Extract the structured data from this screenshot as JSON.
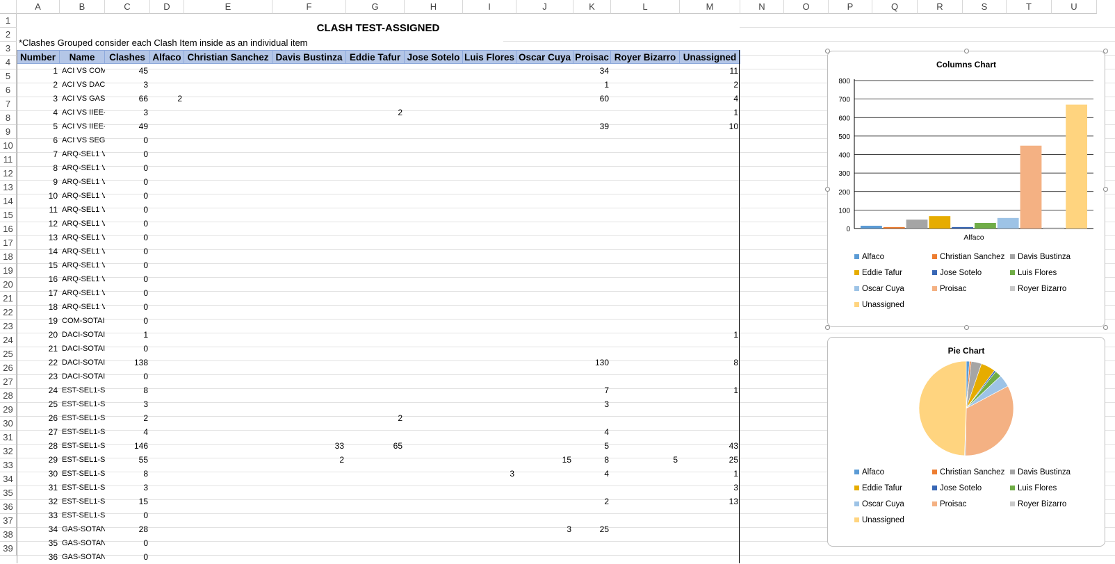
{
  "columns": [
    "A",
    "B",
    "C",
    "D",
    "E",
    "F",
    "G",
    "H",
    "I",
    "J",
    "K",
    "L",
    "M",
    "N",
    "O",
    "P",
    "Q",
    "R",
    "S",
    "T",
    "U"
  ],
  "row_numbers": [
    1,
    2,
    3,
    4,
    5,
    6,
    7,
    8,
    9,
    10,
    11,
    12,
    13,
    14,
    15,
    16,
    17,
    18,
    19,
    20,
    21,
    22,
    23,
    24,
    25,
    26,
    27,
    28,
    29,
    30,
    31,
    32,
    33,
    34,
    35,
    36,
    37,
    38,
    39
  ],
  "title": "CLASH TEST-ASSIGNED",
  "note": "*Clashes Grouped consider each Clash Item inside as an individual item",
  "headers": [
    "Number",
    "Name",
    "Clashes",
    "Alfaco",
    "Christian Sanchez",
    "Davis Bustinza",
    "Eddie Tafur",
    "Jose Sotelo",
    "Luis Flores",
    "Oscar Cuya",
    "Proisac",
    "Royer Bizarro",
    "Unassigned"
  ],
  "rows": [
    {
      "n": "1",
      "name": "ACI VS COM",
      "clashes": "45",
      "vals": [
        "",
        "",
        "",
        "",
        "",
        "",
        "",
        "34",
        "",
        "11"
      ]
    },
    {
      "n": "2",
      "name": "ACI VS DACI",
      "clashes": "3",
      "vals": [
        "",
        "",
        "",
        "",
        "",
        "",
        "",
        "1",
        "",
        "2"
      ]
    },
    {
      "n": "3",
      "name": "ACI VS GAS-",
      "clashes": "66",
      "vals": [
        "2",
        "",
        "",
        "",
        "",
        "",
        "",
        "60",
        "",
        "4"
      ]
    },
    {
      "n": "4",
      "name": "ACI VS IIEE-",
      "clashes": "3",
      "vals": [
        "",
        "",
        "",
        "2",
        "",
        "",
        "",
        "",
        "",
        "1"
      ]
    },
    {
      "n": "5",
      "name": "ACI VS IIEE-",
      "clashes": "49",
      "vals": [
        "",
        "",
        "",
        "",
        "",
        "",
        "",
        "39",
        "",
        "10"
      ]
    },
    {
      "n": "6",
      "name": "ACI VS SEG-",
      "clashes": "0",
      "vals": [
        "",
        "",
        "",
        "",
        "",
        "",
        "",
        "",
        "",
        ""
      ]
    },
    {
      "n": "7",
      "name": "ARQ-SEL1 V",
      "clashes": "0",
      "vals": [
        "",
        "",
        "",
        "",
        "",
        "",
        "",
        "",
        "",
        ""
      ]
    },
    {
      "n": "8",
      "name": "ARQ-SEL1 V",
      "clashes": "0",
      "vals": [
        "",
        "",
        "",
        "",
        "",
        "",
        "",
        "",
        "",
        ""
      ]
    },
    {
      "n": "9",
      "name": "ARQ-SEL1 V",
      "clashes": "0",
      "vals": [
        "",
        "",
        "",
        "",
        "",
        "",
        "",
        "",
        "",
        ""
      ]
    },
    {
      "n": "10",
      "name": "ARQ-SEL1 V",
      "clashes": "0",
      "vals": [
        "",
        "",
        "",
        "",
        "",
        "",
        "",
        "",
        "",
        ""
      ]
    },
    {
      "n": "11",
      "name": "ARQ-SEL1 V",
      "clashes": "0",
      "vals": [
        "",
        "",
        "",
        "",
        "",
        "",
        "",
        "",
        "",
        ""
      ]
    },
    {
      "n": "12",
      "name": "ARQ-SEL1 V",
      "clashes": "0",
      "vals": [
        "",
        "",
        "",
        "",
        "",
        "",
        "",
        "",
        "",
        ""
      ]
    },
    {
      "n": "13",
      "name": "ARQ-SEL1 V",
      "clashes": "0",
      "vals": [
        "",
        "",
        "",
        "",
        "",
        "",
        "",
        "",
        "",
        ""
      ]
    },
    {
      "n": "14",
      "name": "ARQ-SEL1 V",
      "clashes": "0",
      "vals": [
        "",
        "",
        "",
        "",
        "",
        "",
        "",
        "",
        "",
        ""
      ]
    },
    {
      "n": "15",
      "name": "ARQ-SEL1 V",
      "clashes": "0",
      "vals": [
        "",
        "",
        "",
        "",
        "",
        "",
        "",
        "",
        "",
        ""
      ]
    },
    {
      "n": "16",
      "name": "ARQ-SEL1 V",
      "clashes": "0",
      "vals": [
        "",
        "",
        "",
        "",
        "",
        "",
        "",
        "",
        "",
        ""
      ]
    },
    {
      "n": "17",
      "name": "ARQ-SEL1 V",
      "clashes": "0",
      "vals": [
        "",
        "",
        "",
        "",
        "",
        "",
        "",
        "",
        "",
        ""
      ]
    },
    {
      "n": "18",
      "name": "ARQ-SEL1 V",
      "clashes": "0",
      "vals": [
        "",
        "",
        "",
        "",
        "",
        "",
        "",
        "",
        "",
        ""
      ]
    },
    {
      "n": "19",
      "name": "COM-SOTAI",
      "clashes": "0",
      "vals": [
        "",
        "",
        "",
        "",
        "",
        "",
        "",
        "",
        "",
        ""
      ]
    },
    {
      "n": "20",
      "name": "DACI-SOTAI",
      "clashes": "1",
      "vals": [
        "",
        "",
        "",
        "",
        "",
        "",
        "",
        "",
        "",
        "1"
      ]
    },
    {
      "n": "21",
      "name": "DACI-SOTAI",
      "clashes": "0",
      "vals": [
        "",
        "",
        "",
        "",
        "",
        "",
        "",
        "",
        "",
        ""
      ]
    },
    {
      "n": "22",
      "name": "DACI-SOTAI",
      "clashes": "138",
      "vals": [
        "",
        "",
        "",
        "",
        "",
        "",
        "",
        "130",
        "",
        "8"
      ]
    },
    {
      "n": "23",
      "name": "DACI-SOTAI",
      "clashes": "0",
      "vals": [
        "",
        "",
        "",
        "",
        "",
        "",
        "",
        "",
        "",
        ""
      ]
    },
    {
      "n": "24",
      "name": "EST-SEL1-SC",
      "clashes": "8",
      "vals": [
        "",
        "",
        "",
        "",
        "",
        "",
        "",
        "7",
        "",
        "1"
      ]
    },
    {
      "n": "25",
      "name": "EST-SEL1-SC",
      "clashes": "3",
      "vals": [
        "",
        "",
        "",
        "",
        "",
        "",
        "",
        "3",
        "",
        ""
      ]
    },
    {
      "n": "26",
      "name": "EST-SEL1-SC",
      "clashes": "2",
      "vals": [
        "",
        "",
        "",
        "2",
        "",
        "",
        "",
        "",
        "",
        ""
      ]
    },
    {
      "n": "27",
      "name": "EST-SEL1-SC",
      "clashes": "4",
      "vals": [
        "",
        "",
        "",
        "",
        "",
        "",
        "",
        "4",
        "",
        ""
      ]
    },
    {
      "n": "28",
      "name": "EST-SEL1-SC",
      "clashes": "146",
      "vals": [
        "",
        "",
        "33",
        "65",
        "",
        "",
        "",
        "5",
        "",
        "43"
      ]
    },
    {
      "n": "29",
      "name": "EST-SEL1-SC",
      "clashes": "55",
      "vals": [
        "",
        "",
        "2",
        "",
        "",
        "",
        "15",
        "8",
        "5",
        "25"
      ]
    },
    {
      "n": "30",
      "name": "EST-SEL1-SC",
      "clashes": "8",
      "vals": [
        "",
        "",
        "",
        "",
        "",
        "3",
        "",
        "4",
        "",
        "1"
      ]
    },
    {
      "n": "31",
      "name": "EST-SEL1-SC",
      "clashes": "3",
      "vals": [
        "",
        "",
        "",
        "",
        "",
        "",
        "",
        "",
        "",
        "3"
      ]
    },
    {
      "n": "32",
      "name": "EST-SEL1-SC",
      "clashes": "15",
      "vals": [
        "",
        "",
        "",
        "",
        "",
        "",
        "",
        "2",
        "",
        "13"
      ]
    },
    {
      "n": "33",
      "name": "EST-SEL1-SC",
      "clashes": "0",
      "vals": [
        "",
        "",
        "",
        "",
        "",
        "",
        "",
        "",
        "",
        ""
      ]
    },
    {
      "n": "34",
      "name": "GAS-SOTAN",
      "clashes": "28",
      "vals": [
        "",
        "",
        "",
        "",
        "",
        "",
        "3",
        "25",
        "",
        ""
      ]
    },
    {
      "n": "35",
      "name": "GAS-SOTAN",
      "clashes": "0",
      "vals": [
        "",
        "",
        "",
        "",
        "",
        "",
        "",
        "",
        "",
        ""
      ]
    },
    {
      "n": "36",
      "name": "GAS-SOTAN",
      "clashes": "0",
      "vals": [
        "",
        "",
        "",
        "",
        "",
        "",
        "",
        "",
        "",
        ""
      ]
    }
  ],
  "chart_data": [
    {
      "type": "bar",
      "title": "Columns Chart",
      "categories": [
        "Alfaco"
      ],
      "ylim": [
        0,
        800
      ],
      "yticks": [
        "0",
        "100",
        "200",
        "300",
        "400",
        "500",
        "600",
        "700",
        "800"
      ],
      "grid": true,
      "legend": "bottom",
      "series": [
        {
          "name": "Alfaco",
          "values": [
            15
          ],
          "color": "#5b9bd5"
        },
        {
          "name": "Christian Sanchez",
          "values": [
            8
          ],
          "color": "#ed7d31"
        },
        {
          "name": "Davis Bustinza",
          "values": [
            48
          ],
          "color": "#a5a5a5"
        },
        {
          "name": "Eddie Tafur",
          "values": [
            67
          ],
          "color": "#e6ac00"
        },
        {
          "name": "Jose Sotelo",
          "values": [
            8
          ],
          "color": "#3867b5"
        },
        {
          "name": "Luis Flores",
          "values": [
            30
          ],
          "color": "#70ad47"
        },
        {
          "name": "Oscar Cuya",
          "values": [
            57
          ],
          "color": "#9dc3e6"
        },
        {
          "name": "Proisac",
          "values": [
            448
          ],
          "color": "#f4b183"
        },
        {
          "name": "Royer Bizarro",
          "values": [
            5
          ],
          "color": "#c9c9c9"
        },
        {
          "name": "Unassigned",
          "values": [
            670
          ],
          "color": "#ffd47f"
        }
      ]
    },
    {
      "type": "pie",
      "title": "Pie Chart",
      "legend": "bottom",
      "series": [
        {
          "name": "Alfaco",
          "values": [
            15
          ],
          "color": "#5b9bd5"
        },
        {
          "name": "Christian Sanchez",
          "values": [
            8
          ],
          "color": "#ed7d31"
        },
        {
          "name": "Davis Bustinza",
          "values": [
            48
          ],
          "color": "#a5a5a5"
        },
        {
          "name": "Eddie Tafur",
          "values": [
            67
          ],
          "color": "#e6ac00"
        },
        {
          "name": "Jose Sotelo",
          "values": [
            8
          ],
          "color": "#3867b5"
        },
        {
          "name": "Luis Flores",
          "values": [
            30
          ],
          "color": "#70ad47"
        },
        {
          "name": "Oscar Cuya",
          "values": [
            57
          ],
          "color": "#9dc3e6"
        },
        {
          "name": "Proisac",
          "values": [
            448
          ],
          "color": "#f4b183"
        },
        {
          "name": "Royer Bizarro",
          "values": [
            5
          ],
          "color": "#c9c9c9"
        },
        {
          "name": "Unassigned",
          "values": [
            670
          ],
          "color": "#ffd47f"
        }
      ]
    }
  ]
}
